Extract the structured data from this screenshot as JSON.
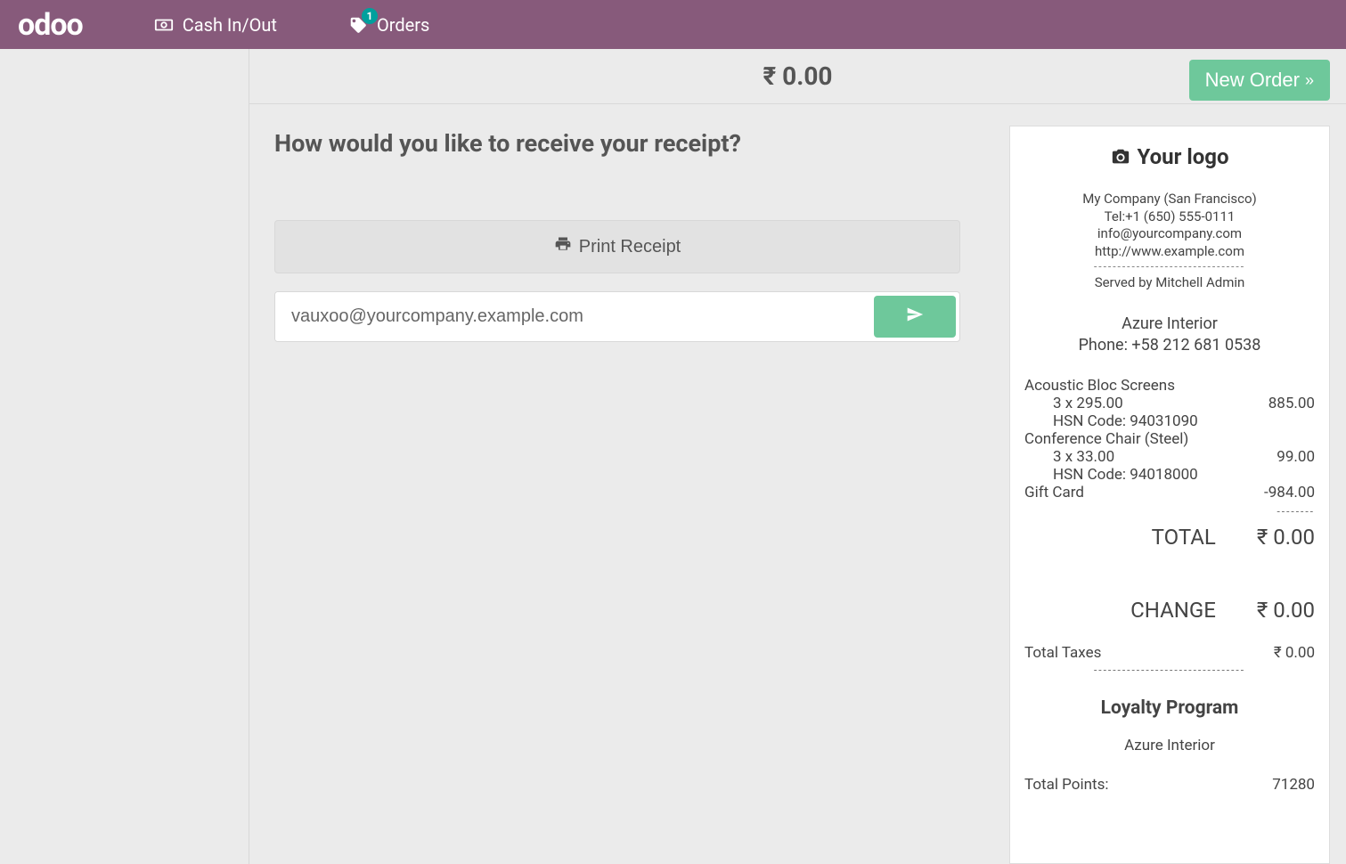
{
  "topbar": {
    "logo_text": "odoo",
    "cash_label": "Cash In/Out",
    "orders_label": "Orders",
    "orders_badge": "1"
  },
  "header": {
    "amount": "₹ 0.00",
    "new_order_label": "New Order"
  },
  "actions": {
    "question": "How would you like to receive your receipt?",
    "print_label": "Print Receipt",
    "email_value": "vauxoo@yourcompany.example.com"
  },
  "receipt": {
    "logo_text": "Your logo",
    "company_name": "My Company (San Francisco)",
    "tel": "Tel:+1 (650) 555-0111",
    "email": "info@yourcompany.com",
    "website": "http://www.example.com",
    "served_by": "Served by Mitchell Admin",
    "customer_name": "Azure Interior",
    "customer_phone": "Phone: +58 212 681 0538",
    "items": [
      {
        "name": "Acoustic Bloc Screens",
        "qty_line": "3 x 295.00",
        "hsn": "HSN Code: 94031090",
        "amount": "885.00"
      },
      {
        "name": "Conference Chair (Steel)",
        "qty_line": "3 x 33.00",
        "hsn": "HSN Code: 94018000",
        "amount": "99.00"
      },
      {
        "name": "Gift Card",
        "qty_line": "",
        "hsn": "",
        "amount": "-984.00"
      }
    ],
    "total_label": "TOTAL",
    "total_value": "₹ 0.00",
    "change_label": "CHANGE",
    "change_value": "₹ 0.00",
    "tax_label": "Total Taxes",
    "tax_value": "₹ 0.00",
    "loyalty_title": "Loyalty Program",
    "loyalty_customer": "Azure Interior",
    "points_label": "Total Points:",
    "points_value": "71280"
  }
}
